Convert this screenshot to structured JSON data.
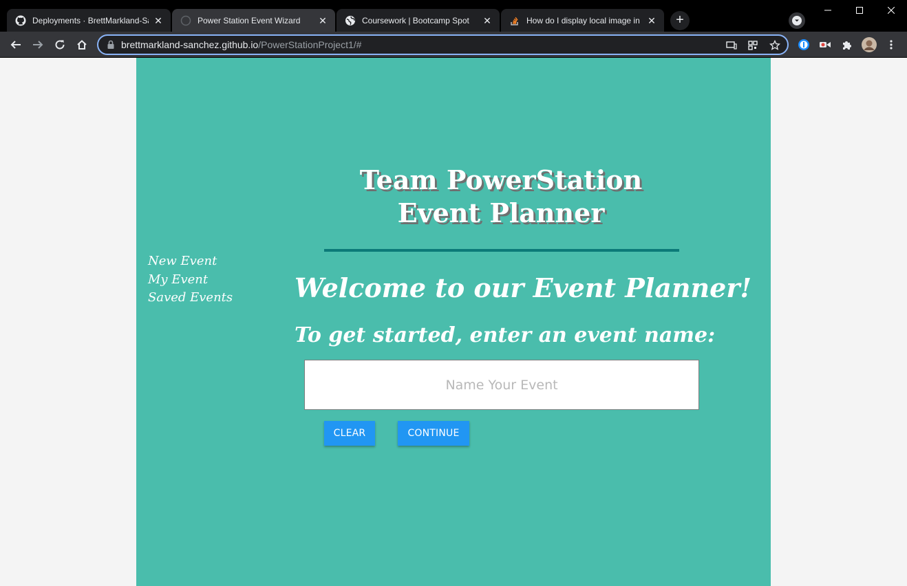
{
  "browser": {
    "tabs": [
      {
        "title": "Deployments · BrettMarkland-Sanchez",
        "icon": "github-icon",
        "active": false
      },
      {
        "title": "Power Station Event Wizard",
        "icon": "globe-icon",
        "active": true
      },
      {
        "title": "Coursework | Bootcamp Spot",
        "icon": "globe-icon",
        "active": false
      },
      {
        "title": "How do I display local image in m",
        "icon": "stackoverflow-icon",
        "active": false
      }
    ],
    "new_tab": "+",
    "close_glyph": "✕",
    "url_host": "brettmarkland-sanchez.github.io",
    "url_path": "/PowerStationProject1/#"
  },
  "page": {
    "nav": [
      "New Event",
      "My Event",
      "Saved Events"
    ],
    "title_line1": "Team PowerStation",
    "title_line2": "Event Planner",
    "welcome": "Welcome to our Event Planner!",
    "subtitle": "To get started, enter an event name:",
    "input_placeholder": "Name Your Event",
    "input_value": "",
    "clear_label": "CLEAR",
    "continue_label": "CONTINUE"
  },
  "colors": {
    "panel": "#4abdac",
    "divider": "#0c7a78",
    "button": "#2196f3",
    "page_bg": "#f4f4f4",
    "omnibox_focus": "#8ab4f8"
  }
}
